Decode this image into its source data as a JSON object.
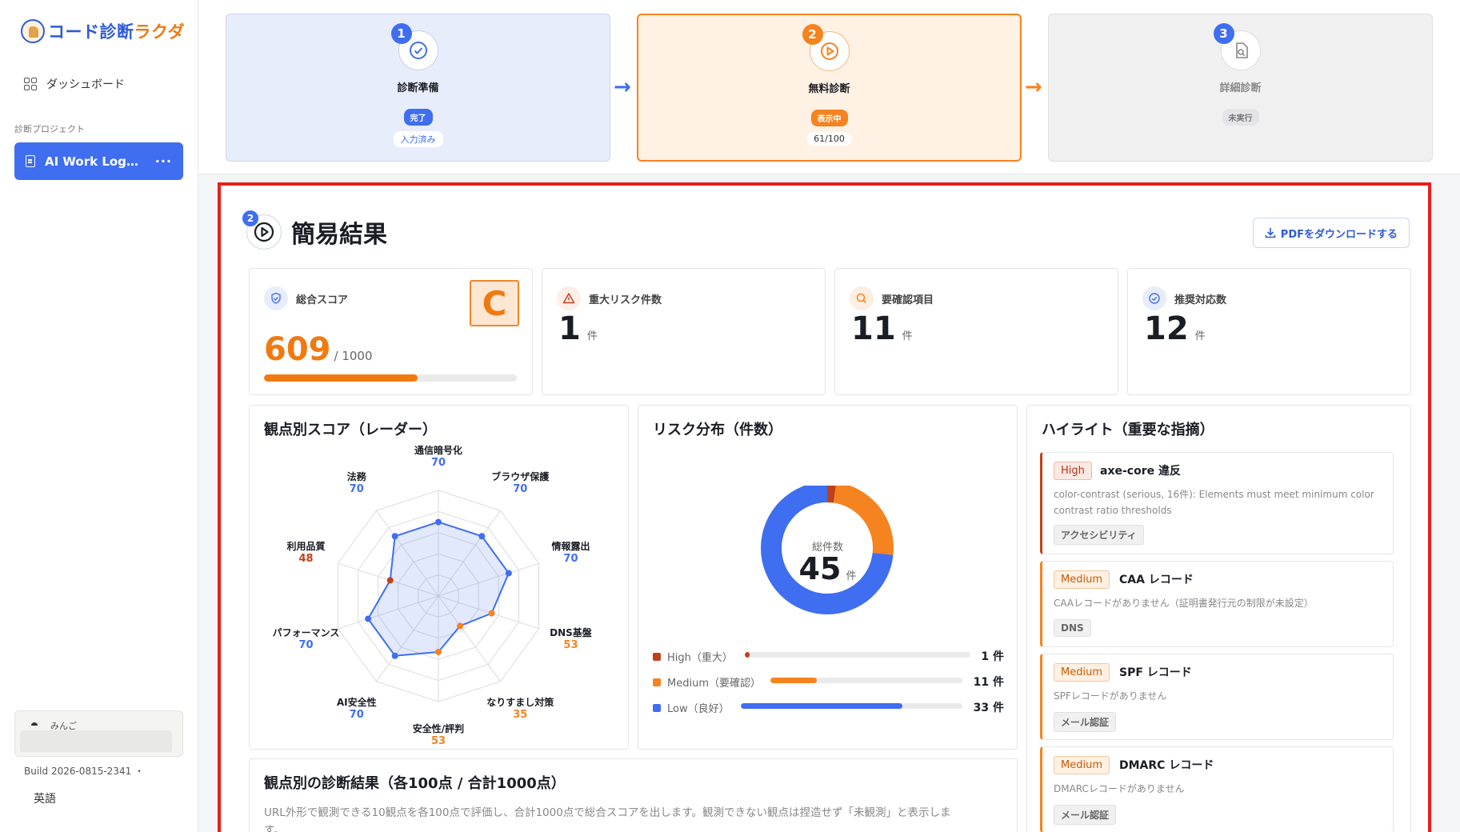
{
  "sidebar": {
    "logo_blue": "コード診断",
    "logo_orange": "ラクダ",
    "dashboard_label": "ダッシュボード",
    "section_label": "診断プロジェクト",
    "project_name": "AI Work Log…",
    "project_menu": "···",
    "user_name": "みんご",
    "build": "Build 2026-0815-2341 ・",
    "language": "英語"
  },
  "steps": [
    {
      "number": "1",
      "title": "診断準備",
      "status": "完了",
      "sub": "入力済み"
    },
    {
      "number": "2",
      "title": "無料診断",
      "status": "表示中",
      "sub": "61/100"
    },
    {
      "number": "3",
      "title": "詳細診断",
      "status": "未実行"
    }
  ],
  "step_arrow": "→",
  "colors": {
    "blue": "#3f6ef0",
    "orange": "#f5831f",
    "high": "#c0401a",
    "gray": "#9a9a9a"
  },
  "header": {
    "badge": "2",
    "title": "簡易結果",
    "pdf_button": "PDFをダウンロードする"
  },
  "kpis": {
    "score": {
      "label": "総合スコア",
      "value": "609",
      "denominator": "/ 1000",
      "grade": "C",
      "fraction": 0.609
    },
    "critical": {
      "label": "重大リスク件数",
      "value": "1",
      "unit": "件"
    },
    "review": {
      "label": "要確認項目",
      "value": "11",
      "unit": "件"
    },
    "recommend": {
      "label": "推奨対応数",
      "value": "12",
      "unit": "件"
    }
  },
  "radar": {
    "title": "観点別スコア（レーダー）",
    "max": 100
  },
  "risk": {
    "title": "リスク分布（件数）",
    "center_label": "総件数",
    "center_value": "45",
    "center_unit": "件",
    "rows": [
      {
        "label": "High（重大）",
        "count": "1 件"
      },
      {
        "label": "Medium（要確認）",
        "count": "11 件"
      },
      {
        "label": "Low（良好）",
        "count": "33 件"
      }
    ]
  },
  "highlights": {
    "title": "ハイライト（重要な指摘）",
    "items": [
      {
        "severity": "High",
        "title": "axe-core 違反",
        "desc": "color-contrast (serious, 16件): Elements must meet minimum color contrast ratio thresholds",
        "tag": "アクセシビリティ"
      },
      {
        "severity": "Medium",
        "title": "CAA レコード",
        "desc": "CAAレコードがありません（証明書発行元の制限が未設定）",
        "tag": "DNS"
      },
      {
        "severity": "Medium",
        "title": "SPF レコード",
        "desc": "SPFレコードがありません",
        "tag": "メール認証"
      },
      {
        "severity": "Medium",
        "title": "DMARC レコード",
        "desc": "DMARCレコードがありません",
        "tag": "メール認証"
      }
    ]
  },
  "results": {
    "title": "観点別の診断結果（各100点 / 合計1000点）",
    "desc": "URL外形で観測できる10観点を各100点で評価し、合計1000点で総合スコアを出します。観測できない観点は捏造せず「未観測」と表示しま",
    "desc_cont": "す。"
  },
  "chart_data": [
    {
      "type": "radar",
      "title": "観点別スコア（レーダー）",
      "ylim": [
        0,
        100
      ],
      "categories": [
        "通信暗号化",
        "ブラウザ保護",
        "情報露出",
        "DNS基盤",
        "なりすまし対策",
        "安全性/評判",
        "AI安全性",
        "パフォーマンス",
        "利用品質",
        "法務"
      ],
      "values": [
        70,
        70,
        70,
        53,
        35,
        53,
        70,
        70,
        48,
        70
      ],
      "value_colors": [
        "#3f6ef0",
        "#3f6ef0",
        "#3f6ef0",
        "#f5831f",
        "#f5831f",
        "#f5831f",
        "#3f6ef0",
        "#3f6ef0",
        "#c0401a",
        "#3f6ef0"
      ]
    },
    {
      "type": "pie",
      "title": "リスク分布（件数）",
      "categories": [
        "High（重大）",
        "Medium（要確認）",
        "Low（良好）"
      ],
      "values": [
        1,
        11,
        33
      ],
      "colors": [
        "#c0401a",
        "#f5831f",
        "#3f6ef0"
      ]
    }
  ]
}
